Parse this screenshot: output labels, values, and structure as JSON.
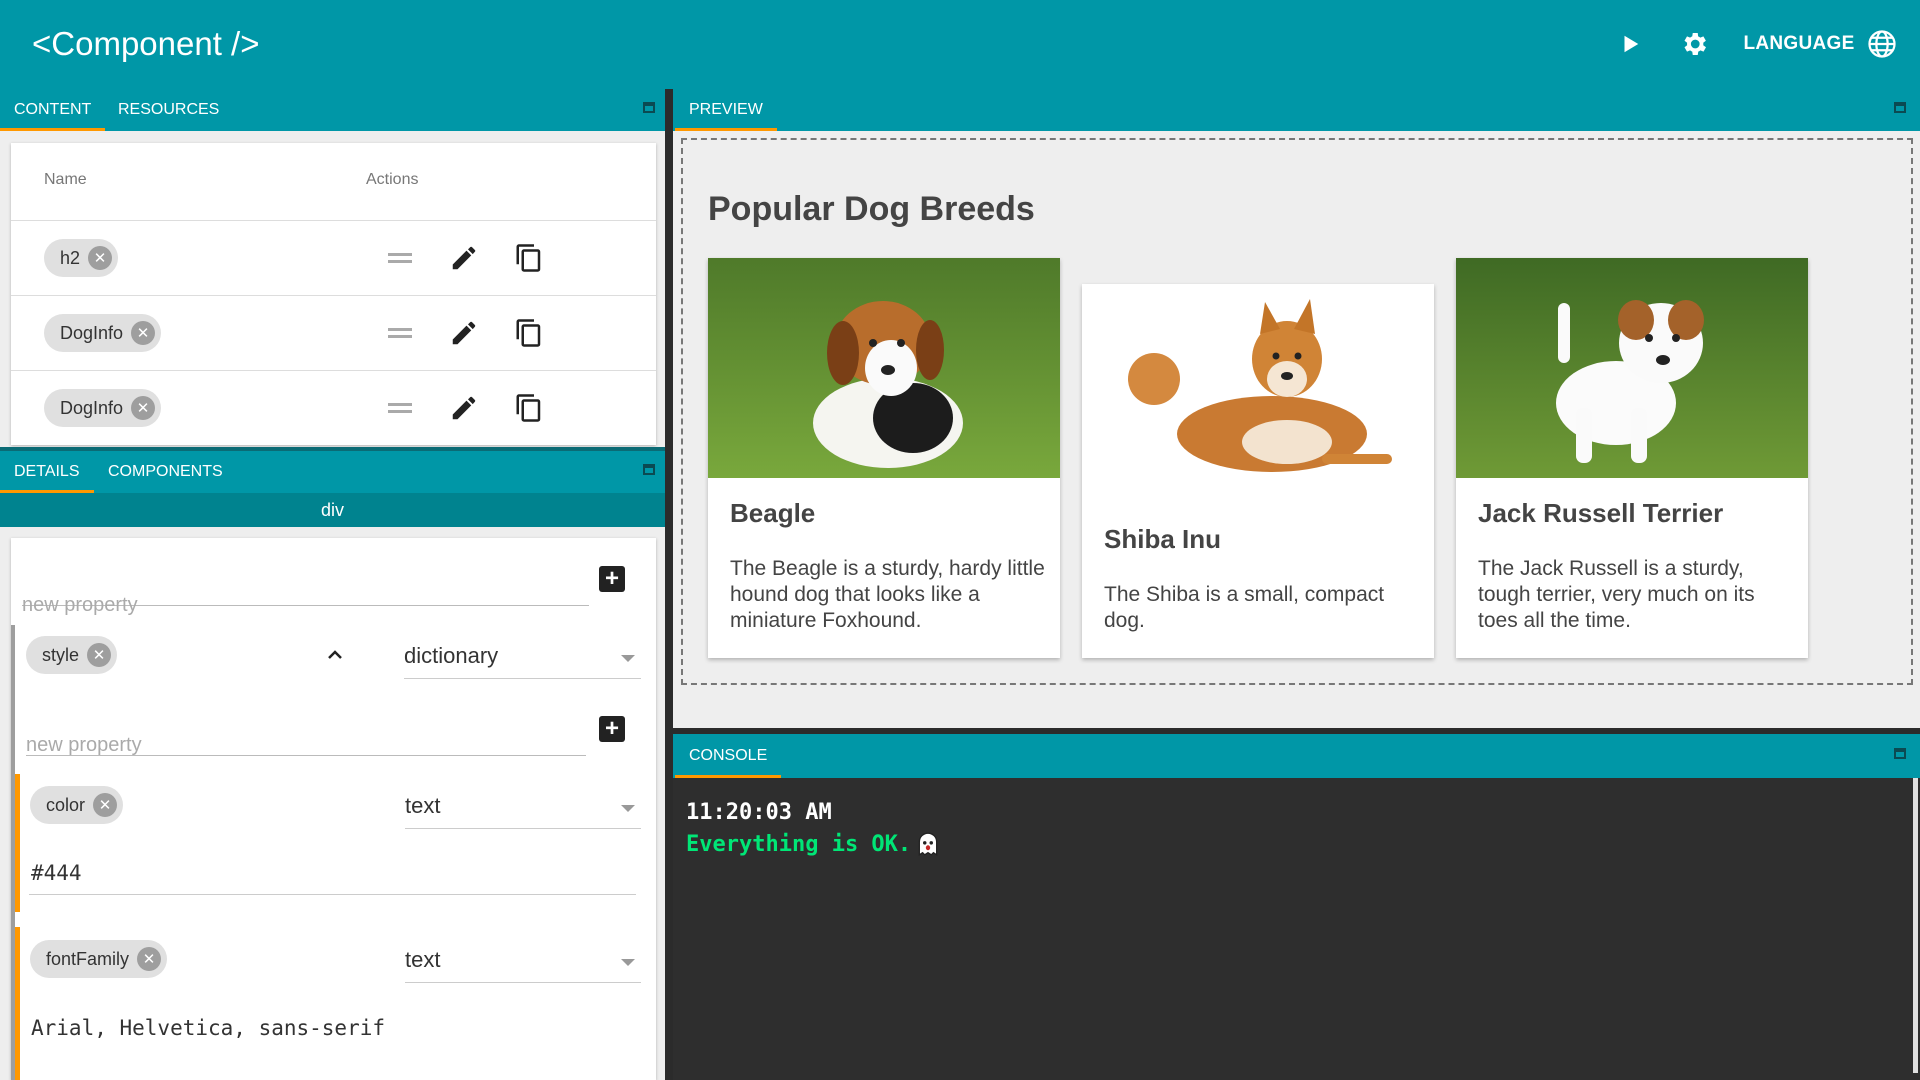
{
  "app": {
    "title": "<Component />",
    "language_label": "LANGUAGE"
  },
  "colors": {
    "primary": "#0097a7",
    "accent": "#ff9800",
    "console_bg": "#2e2e2e",
    "console_ok": "#00e676"
  },
  "left_top": {
    "tabs": [
      {
        "label": "CONTENT",
        "active": true
      },
      {
        "label": "RESOURCES",
        "active": false
      }
    ],
    "columns": {
      "name": "Name",
      "actions": "Actions"
    },
    "rows": [
      {
        "name": "h2"
      },
      {
        "name": "DogInfo"
      },
      {
        "name": "DogInfo"
      }
    ]
  },
  "left_bottom": {
    "tabs": [
      {
        "label": "DETAILS",
        "active": true
      },
      {
        "label": "COMPONENTS",
        "active": false
      }
    ],
    "selected": "div",
    "new_property_placeholder": "new property",
    "style_prop": {
      "name": "style",
      "type": "dictionary"
    },
    "nested_placeholder": "new property",
    "color_prop": {
      "name": "color",
      "type": "text",
      "value": "#444"
    },
    "fontfamily_prop": {
      "name": "fontFamily",
      "type": "text",
      "value": "Arial, Helvetica, sans-serif"
    }
  },
  "preview": {
    "tab": "PREVIEW",
    "heading": "Popular Dog Breeds",
    "dogs": [
      {
        "name": "Beagle",
        "desc": "The Beagle is a sturdy, hardy little hound dog that looks like a miniature Foxhound.",
        "image": "beagle puppy running on grass"
      },
      {
        "name": "Shiba Inu",
        "desc": "The Shiba is a small, compact dog.",
        "image": "shiba inu lying on white background"
      },
      {
        "name": "Jack Russell Terrier",
        "desc": "The Jack Russell is a sturdy, tough terrier, very much on its toes all the time.",
        "image": "jack russell puppy standing on grass"
      }
    ]
  },
  "console": {
    "tab": "CONSOLE",
    "time": "11:20:03 AM",
    "message": "Everything is OK."
  }
}
